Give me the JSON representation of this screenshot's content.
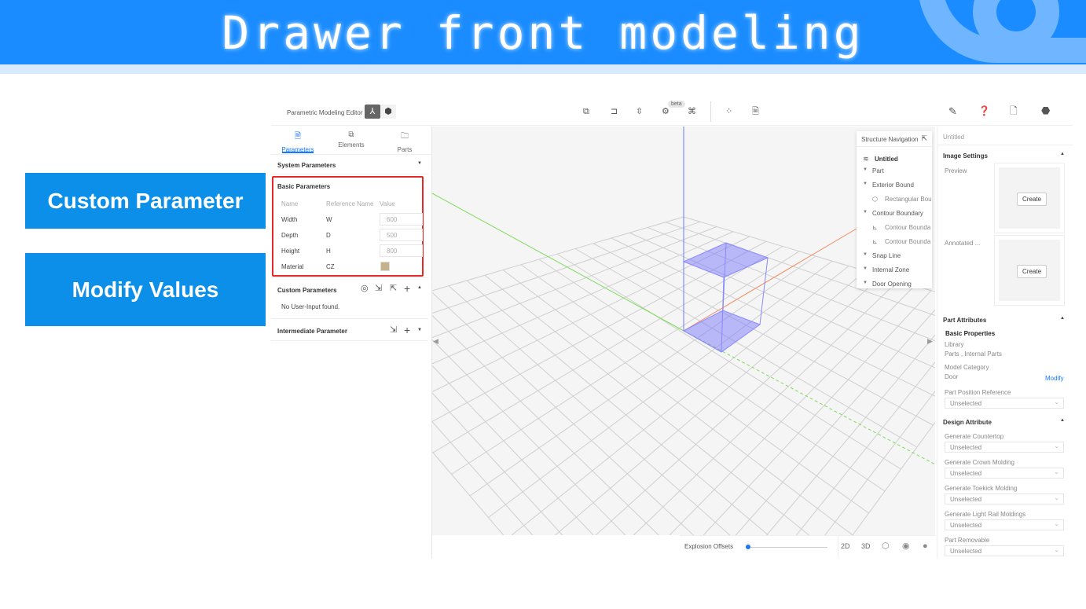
{
  "banner": {
    "title": "Drawer front modeling"
  },
  "callouts": {
    "custom_parameter": "Custom Parameter",
    "modify_values": "Modify Values"
  },
  "header": {
    "title": "Parametric Modeling Editor",
    "beta": "beta"
  },
  "tabs": [
    {
      "label": "Parameters",
      "active": true
    },
    {
      "label": "Elements"
    },
    {
      "label": "Parts"
    }
  ],
  "system_parameters": {
    "title": "System Parameters"
  },
  "basic_parameters": {
    "title": "Basic Parameters",
    "columns": [
      "Name",
      "Reference Name",
      "Value"
    ],
    "rows": [
      {
        "name": "Width",
        "ref": "W",
        "value": "600"
      },
      {
        "name": "Depth",
        "ref": "D",
        "value": "500"
      },
      {
        "name": "Height",
        "ref": "H",
        "value": "800"
      },
      {
        "name": "Material",
        "ref": "CZ",
        "swatch": "#c4b28a"
      }
    ]
  },
  "custom_parameters": {
    "title": "Custom Parameters",
    "empty": "No User-Input found."
  },
  "intermediate_parameter": {
    "title": "Intermediate Parameter"
  },
  "structure_nav": {
    "title": "Structure Navigation",
    "root": "Untitled",
    "items": [
      "Part",
      "Exterior Bound",
      "Rectangular Bou",
      "Contour Boundary",
      "Contour Bounda",
      "Contour Bounda",
      "Snap Line",
      "Internal Zone",
      "Door Opening"
    ]
  },
  "bottombar": {
    "explosion": "Explosion Offsets",
    "mode2d": "2D",
    "mode3d": "3D",
    "explosion_value": 0
  },
  "right_panel": {
    "name": "Untitled",
    "image_settings": "Image Settings",
    "preview": "Preview",
    "annotated": "Annotated ...",
    "create": "Create",
    "part_attributes": "Part Attributes",
    "basic_properties": "Basic Properties",
    "library_label": "Library",
    "library_value": "Parts , Internal Parts",
    "model_category_label": "Model Category",
    "model_category_value": "Door",
    "modify": "Modify",
    "part_position_reference": "Part Position Reference",
    "design_attribute": "Design Attribute",
    "unselected": "Unselected",
    "design_fields": [
      "Generate Countertop",
      "Generate Crown Molding",
      "Generate Toekick Molding",
      "Generate Light Rail Moldings",
      "Part Removable"
    ]
  }
}
